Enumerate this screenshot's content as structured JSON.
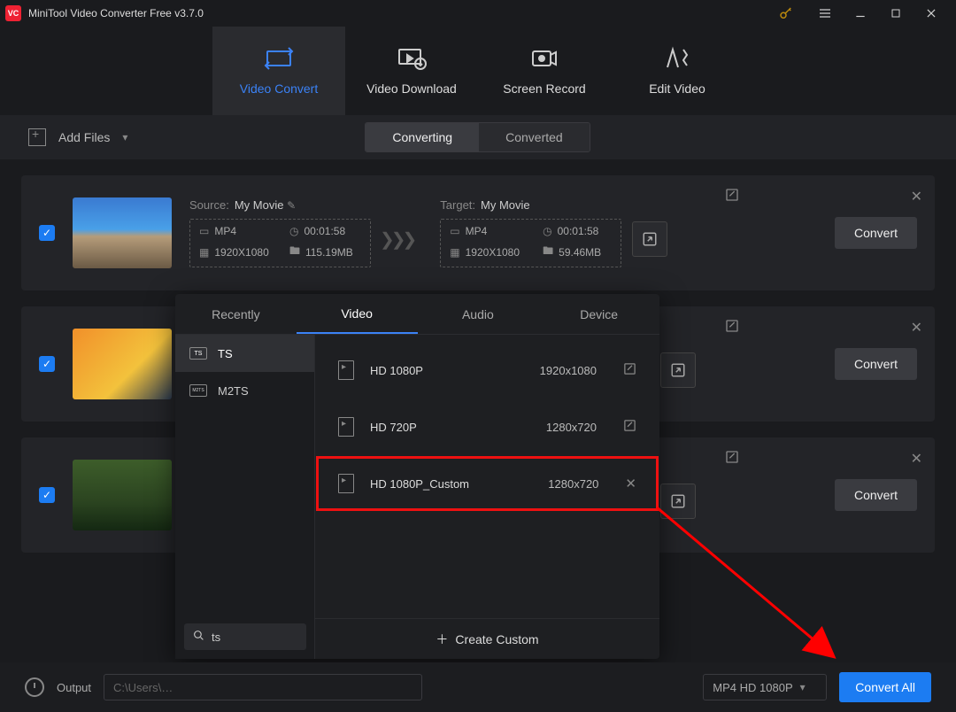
{
  "titlebar": {
    "title": "MiniTool Video Converter Free v3.7.0"
  },
  "nav": {
    "convert": "Video Convert",
    "download": "Video Download",
    "record": "Screen Record",
    "edit": "Edit Video"
  },
  "toolbar": {
    "add_files": "Add Files",
    "seg_converting": "Converting",
    "seg_converted": "Converted"
  },
  "task_common": {
    "source_label": "Source:",
    "target_label": "Target:",
    "convert": "Convert"
  },
  "tasks": [
    {
      "name": "My Movie",
      "src_fmt": "MP4",
      "src_dur": "00:01:58",
      "src_res": "1920X1080",
      "src_size": "115.19MB",
      "tgt_fmt": "MP4",
      "tgt_dur": "00:01:58",
      "tgt_res": "1920X1080",
      "tgt_size": "59.46MB",
      "thumb_css": "linear-gradient(180deg,#3a7ad1 0%,#49a0e8 45%,#b59c7a 55%,#6b5a45 100%)"
    },
    {
      "name": "",
      "thumb_css": "linear-gradient(135deg,#f1902a,#f3c23c 60%,#2b3a50)"
    },
    {
      "name": "",
      "thumb_css": "linear-gradient(180deg,#3d5d2a,#2b4420 60%,#142812)"
    }
  ],
  "popup": {
    "tabs": {
      "recent": "Recently",
      "video": "Video",
      "audio": "Audio",
      "device": "Device"
    },
    "formats": [
      {
        "label": "TS",
        "active": true
      },
      {
        "label": "M2TS",
        "active": false
      }
    ],
    "presets": [
      {
        "name": "HD 1080P",
        "res": "1920x1080",
        "icon": "edit"
      },
      {
        "name": "HD 720P",
        "res": "1280x720",
        "icon": "edit"
      },
      {
        "name": "HD 1080P_Custom",
        "res": "1280x720",
        "icon": "close",
        "highlight": true
      }
    ],
    "search_value": "ts",
    "create_label": "Create Custom"
  },
  "bottom": {
    "output_label": "Output",
    "output_path": "C:\\Users\\…",
    "format": "MP4 HD 1080P",
    "convert_all": "Convert All"
  }
}
